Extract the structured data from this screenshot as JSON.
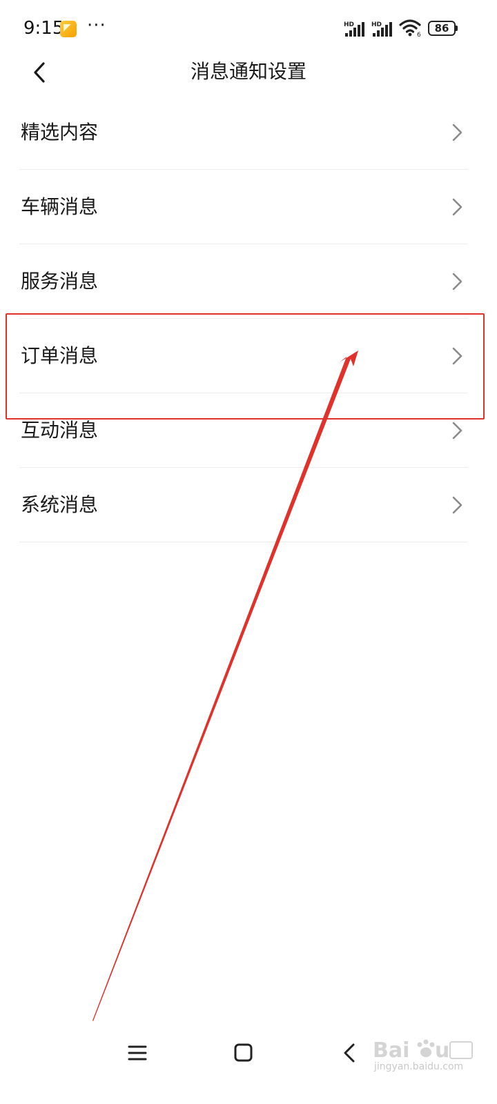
{
  "status_bar": {
    "time": "9:15",
    "more": "···",
    "battery_level": "86",
    "network_1": "HD",
    "network_2": "HD",
    "wifi_badge": "6"
  },
  "header": {
    "title": "消息通知设置"
  },
  "menu": {
    "items": [
      {
        "label": "精选内容"
      },
      {
        "label": "车辆消息"
      },
      {
        "label": "服务消息"
      },
      {
        "label": "订单消息"
      },
      {
        "label": "互动消息"
      },
      {
        "label": "系统消息"
      }
    ]
  },
  "annotation": {
    "highlighted_item": "订单消息",
    "color": "#e0312b"
  },
  "watermark": {
    "url": "jingyan.baidu.com"
  },
  "colors": {
    "text": "#1a1a1a",
    "divider": "#ececec",
    "chevron": "#8a8a8a",
    "annotation": "#e0312b"
  }
}
